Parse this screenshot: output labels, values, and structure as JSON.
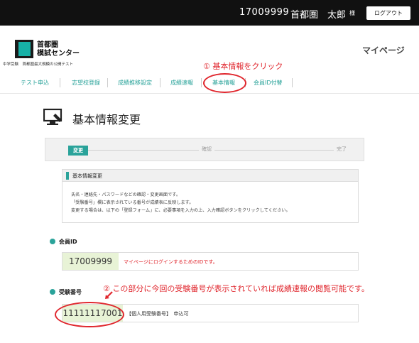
{
  "topbar": {
    "user_id": "17009999",
    "user_name": "首都圏　太郎",
    "honorific": "様",
    "logout_label": "ログアウト"
  },
  "header": {
    "logo_line1": "首都圏",
    "logo_line2": "模試センター",
    "logo_sub": "中学受験　首都圏最大規模の公開テスト",
    "mypage_label": "マイページ"
  },
  "annotation": {
    "step1": "① 基本情報をクリック",
    "step2": "② この部分に今回の受験番号が表示されていれば成績速報の閲覧可能です。"
  },
  "nav": {
    "items": [
      {
        "label": "テスト申込"
      },
      {
        "label": "志望校登録"
      },
      {
        "label": "成績推移設定"
      },
      {
        "label": "成績速報"
      },
      {
        "label": "基本情報"
      },
      {
        "label": "会員ID付替"
      }
    ]
  },
  "page": {
    "title": "基本情報変更"
  },
  "steps": {
    "active": "変更",
    "middle": "確認",
    "end": "完了"
  },
  "info": {
    "heading": "基本情報変更",
    "line1": "氏名・連絡先・パスワードなどの確認・変更画面です。",
    "line2": "「受験番号」欄に表示されている番号が成績表に反映します。",
    "line3": "変更する場合は、以下の「登録フォーム」に、必要事項を入力の上、入力確認ボタンをクリックしてください。"
  },
  "member": {
    "label": "会員ID",
    "value": "17009999",
    "note": "マイページにログインするためのIDです。"
  },
  "exam": {
    "label": "受験番号",
    "value": "11111117001",
    "note": "【個人用受験番号】　申込可"
  },
  "colors": {
    "accent": "#2aa39a",
    "annotation": "#e0262d",
    "field_bg": "#e8f3d6"
  }
}
